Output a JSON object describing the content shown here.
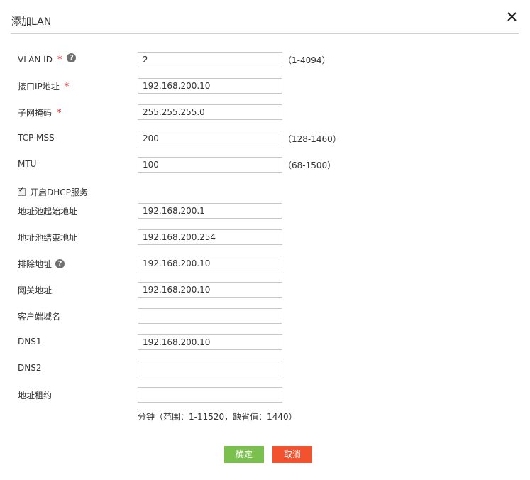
{
  "dialog": {
    "title": "添加LAN",
    "close_glyph": "✕"
  },
  "fields": {
    "vlan_id": {
      "label": "VLAN ID",
      "value": "2",
      "hint": "（1-4094）",
      "required": "*",
      "help": "?"
    },
    "interface_ip": {
      "label": "接口IP地址",
      "value": "192.168.200.10",
      "required": "*"
    },
    "subnet_mask": {
      "label": "子网掩码",
      "value": "255.255.255.0",
      "required": "*"
    },
    "tcp_mss": {
      "label": "TCP MSS",
      "value": "200",
      "hint": "（128-1460）"
    },
    "mtu": {
      "label": "MTU",
      "value": "100",
      "hint": "（68-1500）"
    }
  },
  "dhcp": {
    "enable_label": "开启DHCP服务",
    "checked": true,
    "check_glyph": "✔",
    "pool_start": {
      "label": "地址池起始地址",
      "value": "192.168.200.1"
    },
    "pool_end": {
      "label": "地址池结束地址",
      "value": "192.168.200.254"
    },
    "exclude": {
      "label": "排除地址",
      "value": "192.168.200.10",
      "help": "?"
    },
    "gateway": {
      "label": "网关地址",
      "value": "192.168.200.10"
    },
    "client_domain": {
      "label": "客户端域名",
      "value": ""
    },
    "dns1": {
      "label": "DNS1",
      "value": "192.168.200.10"
    },
    "dns2": {
      "label": "DNS2",
      "value": ""
    },
    "lease": {
      "label": "地址租约",
      "value": "",
      "note": "分钟（范围：1-11520，缺省值：1440）"
    }
  },
  "buttons": {
    "ok": "确定",
    "cancel": "取消"
  },
  "colors": {
    "ok_button": "#7bbf4e",
    "cancel_button": "#f2522e",
    "required_star": "#e02020",
    "help_icon": "#707070"
  },
  "icons": {
    "close": "close-icon",
    "help": "question-circle-icon",
    "check": "checkbox-icon"
  }
}
